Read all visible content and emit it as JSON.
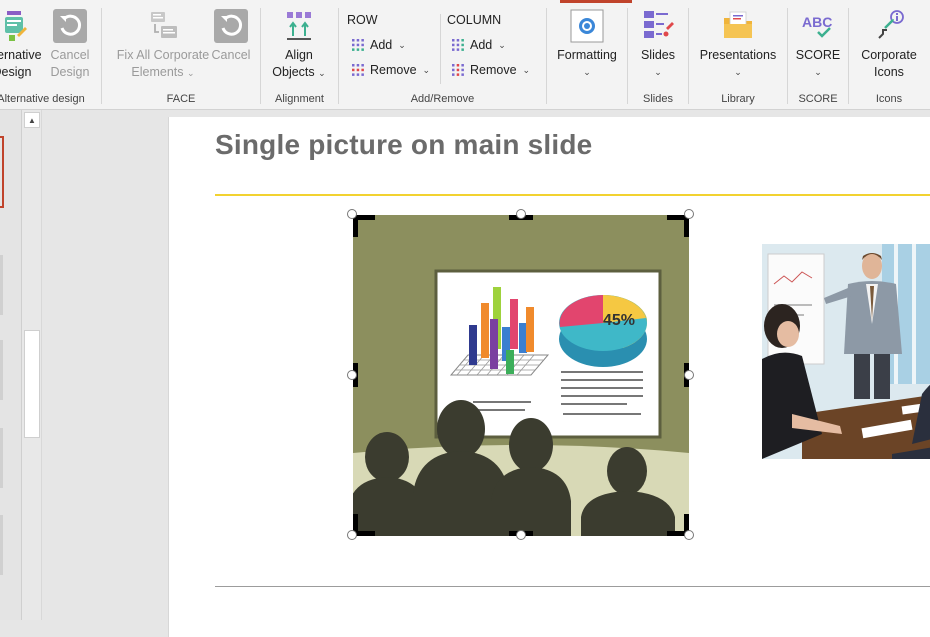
{
  "ribbon": {
    "alternative_design": {
      "button_line1": "Alternative",
      "button_line2": "Design",
      "cancel_line1": "Cancel",
      "cancel_line2": "Design",
      "group_label": "Alternative design"
    },
    "face": {
      "fix_line1": "Fix All Corporate",
      "fix_line2": "Elements",
      "cancel_label": "Cancel",
      "group_label": "FACE"
    },
    "alignment": {
      "align_line1": "Align",
      "align_line2": "Objects",
      "group_label": "Alignment"
    },
    "add_remove": {
      "row_header": "ROW",
      "row_add": "Add",
      "row_remove": "Remove",
      "column_header": "COLUMN",
      "column_add": "Add",
      "column_remove": "Remove",
      "group_label": "Add/Remove"
    },
    "formatting": {
      "label": "Formatting"
    },
    "slides": {
      "button_label": "Slides",
      "group_label": "Slides"
    },
    "library": {
      "button_label": "Presentations",
      "group_label": "Library"
    },
    "score": {
      "button_label": "SCORE",
      "icon_text": "ABC",
      "group_label": "SCORE"
    },
    "icons": {
      "button_line1": "Corporate",
      "button_line2": "Icons",
      "group_label": "Icons"
    }
  },
  "slide": {
    "title": "Single picture on main slide",
    "chart_label": "45%"
  },
  "colors": {
    "accent": "#c0432b",
    "title": "#6b6b6b",
    "rule_yellow": "#f2d230",
    "picture_bg": "#8c8f5e",
    "silhouette": "#3b3c2f"
  }
}
